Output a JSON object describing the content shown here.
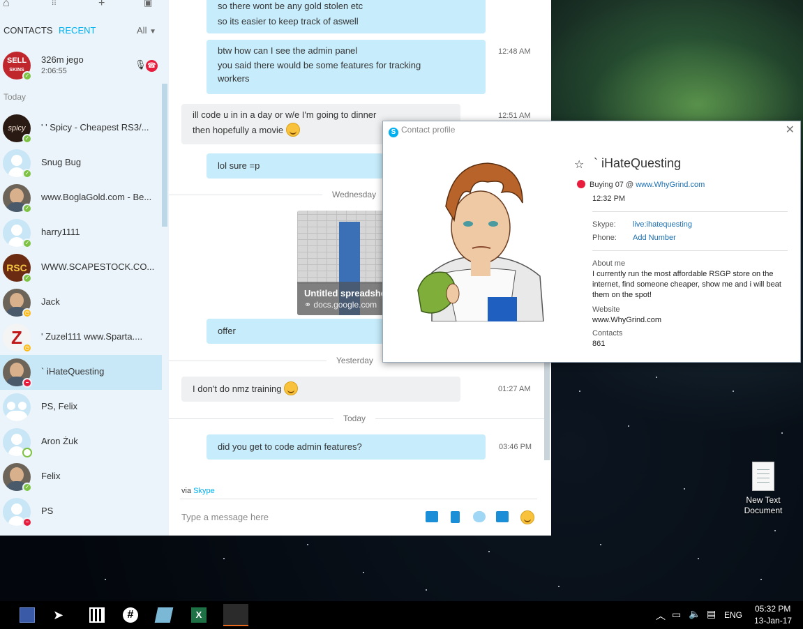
{
  "sidebar": {
    "tabs": {
      "contacts": "CONTACTS",
      "recent": "RECENT",
      "filter": "All"
    },
    "call": {
      "name": "326m jego",
      "duration": "2:06:55",
      "avatar_text": "SELL\nSKINS"
    },
    "section_today": "Today",
    "contacts": [
      {
        "name": "' ' Spicy - Cheapest RS3/...",
        "status": "online",
        "avatar": "spicy"
      },
      {
        "name": "Snug Bug",
        "status": "online",
        "avatar": "default"
      },
      {
        "name": "www.BoglaGold.com - Be...",
        "status": "online",
        "avatar": "photo"
      },
      {
        "name": "harry1111",
        "status": "online",
        "avatar": "default"
      },
      {
        "name": "WWW.SCAPESTOCK.CO...",
        "status": "online",
        "avatar": "rsc"
      },
      {
        "name": "Jack",
        "status": "away",
        "avatar": "photo"
      },
      {
        "name": "' Zuzel111   www.Sparta....",
        "status": "away",
        "avatar": "z"
      },
      {
        "name": "`   iHateQuesting",
        "status": "busy",
        "avatar": "photo",
        "active": true
      },
      {
        "name": "PS, Felix",
        "status": "none",
        "avatar": "group"
      },
      {
        "name": "Aron Żuk",
        "status": "offline",
        "avatar": "default"
      },
      {
        "name": "Felix",
        "status": "online",
        "avatar": "photo"
      },
      {
        "name": "PS",
        "status": "busy",
        "avatar": "default"
      }
    ]
  },
  "chat": {
    "messages": [
      {
        "text1": "so there wont be any gold stolen etc",
        "text2": "so its easier to keep track of aswell"
      },
      {
        "text1": "btw how can I see the admin panel",
        "text2": "you said there would be some features for tracking",
        "text3": "workers",
        "time": "12:48 AM"
      },
      {
        "text1": "ill code u in in a day or w/e I'm going to dinner",
        "text2": "then hopefully a movie",
        "time": "12:51 AM"
      },
      {
        "text1": "lol sure =p"
      },
      {
        "text1": "offer"
      },
      {
        "text1": "I don't do nmz training",
        "time": "01:27 AM"
      },
      {
        "text1": "did you get to code admin features?",
        "time": "03:46 PM"
      }
    ],
    "days": {
      "wednesday": "Wednesday",
      "yesterday": "Yesterday",
      "today": "Today"
    },
    "attachment": {
      "title": "Untitled spreadsheet",
      "url": "docs.google.com"
    },
    "via_prefix": "via",
    "via_link": "Skype",
    "input_placeholder": "Type a message here"
  },
  "profile": {
    "window_title": "Contact profile",
    "name": "`   iHateQuesting",
    "mood": "Buying 07  @",
    "mood_link": "www.WhyGrind.com",
    "local_time": "12:32 PM",
    "skype_label": "Skype:",
    "skype_value": "live:ihatequesting",
    "phone_label": "Phone:",
    "phone_value": "Add Number",
    "about_label": "About me",
    "about_text": "I currently run the most affordable RSGP store on the internet, find someone cheaper, show me and i will beat them on the spot!",
    "website_label": "Website",
    "website_value": "www.WhyGrind.com",
    "contacts_label": "Contacts",
    "contacts_value": "861"
  },
  "desktop": {
    "icon_label_1": "New Text",
    "icon_label_2": "Document"
  },
  "taskbar": {
    "lang": "ENG",
    "time": "05:32 PM",
    "date": "13-Jan-17"
  },
  "colors": {
    "skype_blue": "#00aff0",
    "bubble_out": "#c7ecfb",
    "bubble_in": "#eef0f2",
    "online": "#7dc242",
    "away": "#fdb813",
    "busy": "#e81c3c"
  }
}
